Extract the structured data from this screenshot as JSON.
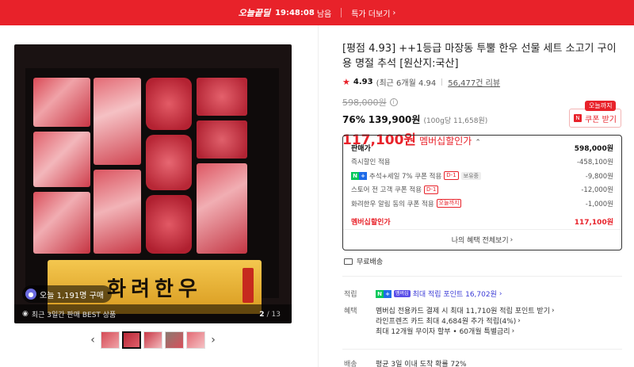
{
  "banner": {
    "brand": "오늘끝딜",
    "timer": "19:48:08",
    "remaining": "남음",
    "more_label": "특가 더보기",
    "chevron": "›"
  },
  "gallery": {
    "plate_text": "화려한우",
    "buy_today": "오늘 1,191명 구매",
    "best_text": "최근 3일간 판매 BEST 상품",
    "page_current": "2",
    "page_total": "/ 13",
    "prev": "‹",
    "next": "›"
  },
  "product": {
    "title": "[평점 4.93] ++1등급 마장동 투뿔 한우 선물 세트 소고기 구이용 명절 추석 [원산지:국산]",
    "star": "★",
    "rating": "4.93",
    "rating_note": "(최근 6개월 4.94",
    "reviews": "56,477건 리뷰",
    "original_price": "598,000원",
    "discount_pct": "76%",
    "discount_price": "139,900원",
    "unit_price": "(100g당 11,658원)",
    "member_price": "117,100원",
    "member_label": "멤버십할인가",
    "member_caret": "⌃"
  },
  "coupon": {
    "tag": "오늘까지",
    "label": "쿠폰 받기"
  },
  "breakdown": {
    "rows": [
      {
        "label": "판매가",
        "value": "598,000원"
      },
      {
        "label": "즉시할인 적용",
        "value": "-458,100원"
      },
      {
        "label": "추석+세일 7% 쿠폰 적용",
        "badge": "D-1",
        "badge2": "보유중",
        "value": "-9,800원"
      },
      {
        "label": "스토어 전 고객 쿠폰 적용",
        "badge": "D-1",
        "value": "-12,000원"
      },
      {
        "label": "화려한우 알림 동의 쿠폰 적용",
        "badge": "오늘까지",
        "value": "-1,000원"
      }
    ],
    "total_label": "멤버십할인가",
    "total_value": "117,100원",
    "my_benefit": "나의 혜택 전체보기",
    "npay_n": "N",
    "npay_p": "+"
  },
  "shipping": {
    "free": "무료배송",
    "key": "배송",
    "value": "평균 3일 이내 도착 확률 72%"
  },
  "points": {
    "key": "적립",
    "badge": "멤버십",
    "text": "최대 적립 포인트 16,702원"
  },
  "benefits": {
    "key": "혜택",
    "lines": [
      "멤버십 전용카드 결제 시 최대 11,710원 적립 포인트 받기",
      "라인프렌즈 카드 최대 4,684원 추가 적립(4%)",
      "최대 12개월 무이자 할부 • 60개월 특별금리"
    ]
  }
}
